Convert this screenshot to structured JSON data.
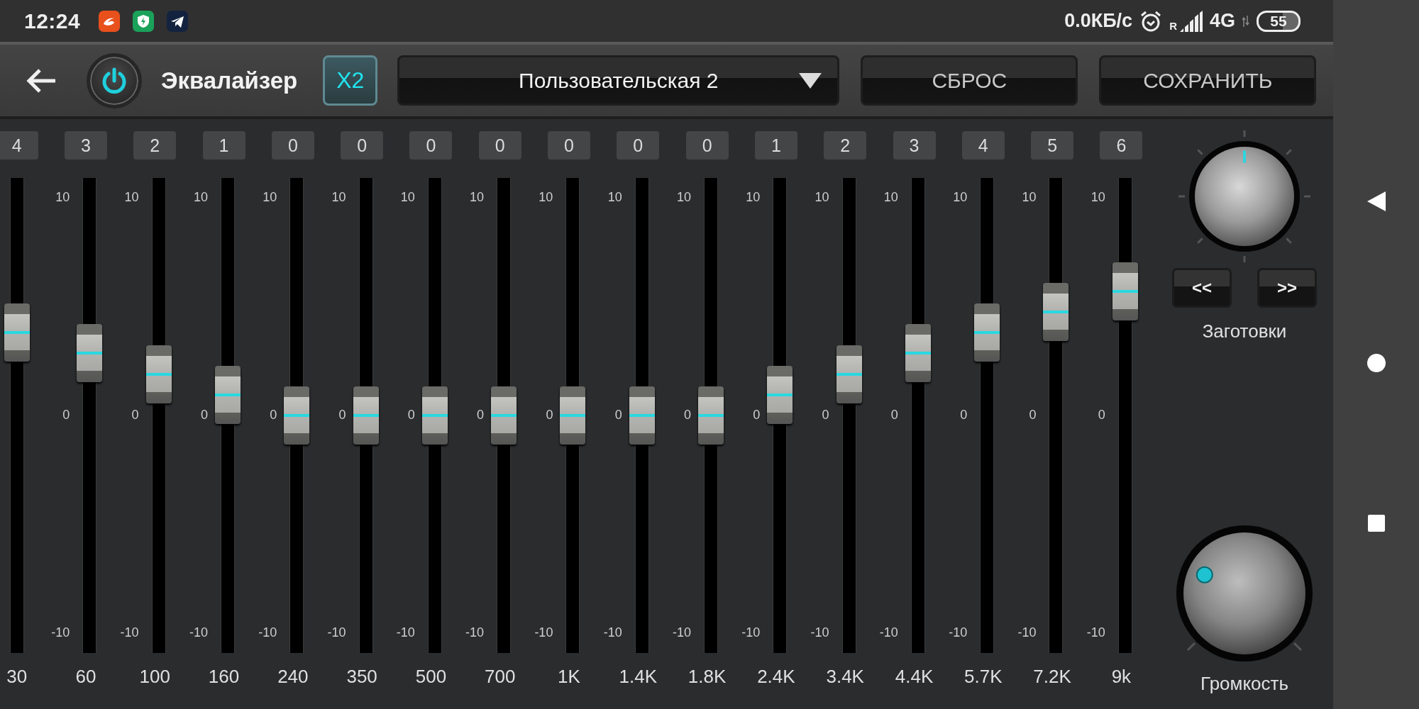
{
  "status_bar": {
    "time": "12:24",
    "notifications": [
      {
        "kind": "swirl"
      },
      {
        "kind": "shield"
      },
      {
        "kind": "plane"
      }
    ],
    "network_speed": "0.0КБ/с",
    "roaming": "R",
    "network_type": "4G",
    "battery": "55"
  },
  "header": {
    "title": "Эквалайзер",
    "power": {
      "on": true
    },
    "x2": {
      "label": "X2",
      "selected": true
    },
    "preset": {
      "value": "Пользовательская 2"
    },
    "buttons": [
      "СБРОС",
      "СОХРАНИТЬ"
    ]
  },
  "bands": [
    {
      "value": "4",
      "level": 0.7,
      "frequency": "30"
    },
    {
      "value": "3",
      "level": 0.65,
      "scale": [
        "10",
        "0",
        "-10"
      ],
      "frequency": "60"
    },
    {
      "value": "2",
      "level": 0.6,
      "scale": [
        "10",
        "0",
        "-10"
      ],
      "frequency": "100"
    },
    {
      "value": "1",
      "level": 0.55,
      "scale": [
        "10",
        "0",
        "-10"
      ],
      "frequency": "160"
    },
    {
      "value": "0",
      "level": 0.5,
      "scale": [
        "10",
        "0",
        "-10"
      ],
      "frequency": "240"
    },
    {
      "value": "0",
      "level": 0.5,
      "scale": [
        "10",
        "0",
        "-10"
      ],
      "frequency": "350"
    },
    {
      "value": "0",
      "level": 0.5,
      "scale": [
        "10",
        "0",
        "-10"
      ],
      "frequency": "500"
    },
    {
      "value": "0",
      "level": 0.5,
      "scale": [
        "10",
        "0",
        "-10"
      ],
      "frequency": "700"
    },
    {
      "value": "0",
      "level": 0.5,
      "scale": [
        "10",
        "0",
        "-10"
      ],
      "frequency": "1K"
    },
    {
      "value": "0",
      "level": 0.5,
      "scale": [
        "10",
        "0",
        "-10"
      ],
      "frequency": "1.4K"
    },
    {
      "value": "0",
      "level": 0.5,
      "scale": [
        "10",
        "0",
        "-10"
      ],
      "frequency": "1.8K"
    },
    {
      "value": "1",
      "level": 0.55,
      "scale": [
        "10",
        "0",
        "-10"
      ],
      "frequency": "2.4K"
    },
    {
      "value": "2",
      "level": 0.6,
      "scale": [
        "10",
        "0",
        "-10"
      ],
      "frequency": "3.4K"
    },
    {
      "value": "3",
      "level": 0.65,
      "scale": [
        "10",
        "0",
        "-10"
      ],
      "frequency": "4.4K"
    },
    {
      "value": "4",
      "level": 0.7,
      "scale": [
        "10",
        "0",
        "-10"
      ],
      "frequency": "5.7K"
    },
    {
      "value": "5",
      "level": 0.75,
      "scale": [
        "10",
        "0",
        "-10"
      ],
      "frequency": "7.2K"
    },
    {
      "value": "6",
      "level": 0.8,
      "scale": [
        "10",
        "0",
        "-10"
      ],
      "frequency": "9k"
    }
  ],
  "presets_panel": {
    "prev": "<<",
    "next": ">>",
    "label": "Заготовки"
  },
  "volume": {
    "label": "Громкость"
  }
}
